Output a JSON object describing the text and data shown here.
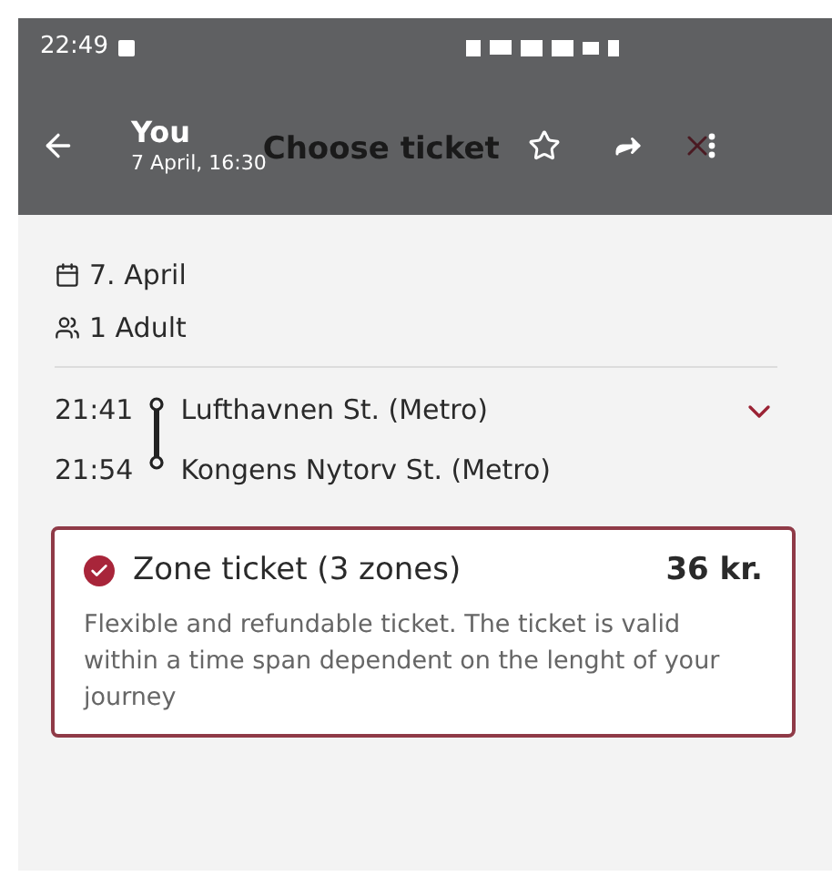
{
  "status_bar": {
    "time": "22:49"
  },
  "toolbar": {
    "title": "You",
    "subtitle": "7 April, 16:30",
    "overlay_title": "Choose ticket"
  },
  "trip": {
    "date": "7. April",
    "passengers": "1 Adult",
    "expanded": false,
    "stops": [
      {
        "time": "21:41",
        "name": "Lufthavnen St. (Metro)"
      },
      {
        "time": "21:54",
        "name": "Kongens Nytorv St. (Metro)"
      }
    ]
  },
  "tickets": [
    {
      "name": "Zone ticket (3 zones)",
      "price": "36 kr.",
      "description": "Flexible and refundable ticket. The ticket is valid within a time span dependent on the lenght of your journey",
      "selected": true
    }
  ]
}
